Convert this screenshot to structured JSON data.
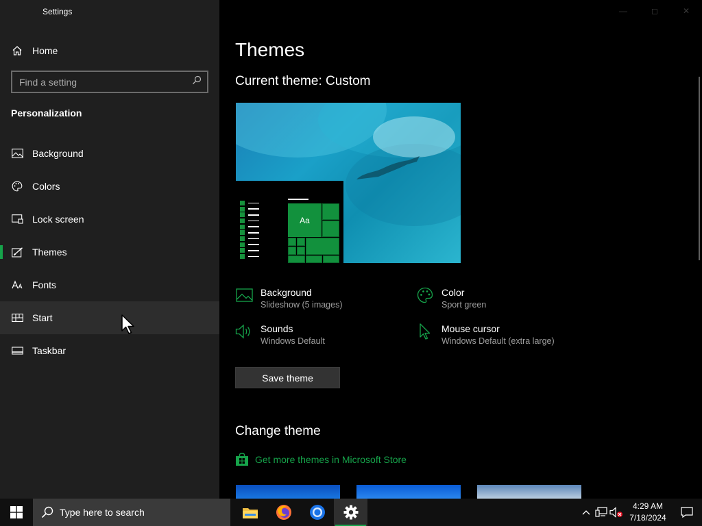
{
  "app": {
    "title": "Settings"
  },
  "sidebar": {
    "home_label": "Home",
    "search_placeholder": "Find a setting",
    "section_title": "Personalization",
    "items": [
      {
        "label": "Background",
        "icon": "picture-icon"
      },
      {
        "label": "Colors",
        "icon": "palette-icon"
      },
      {
        "label": "Lock screen",
        "icon": "lock-screen-icon"
      },
      {
        "label": "Themes",
        "icon": "brush-icon",
        "selected": true
      },
      {
        "label": "Fonts",
        "icon": "font-icon"
      },
      {
        "label": "Start",
        "icon": "start-icon",
        "hovered": true
      },
      {
        "label": "Taskbar",
        "icon": "taskbar-icon"
      }
    ]
  },
  "main": {
    "title": "Themes",
    "current_theme": "Current theme: Custom",
    "preview_tile_text": "Aa",
    "properties": [
      {
        "title": "Background",
        "subtitle": "Slideshow (5 images)",
        "icon": "picture-icon"
      },
      {
        "title": "Color",
        "subtitle": "Sport green",
        "icon": "palette-icon"
      },
      {
        "title": "Sounds",
        "subtitle": "Windows Default",
        "icon": "speaker-icon"
      },
      {
        "title": "Mouse cursor",
        "subtitle": "Windows Default (extra large)",
        "icon": "cursor-icon"
      }
    ],
    "save_button": "Save theme",
    "change_title": "Change theme",
    "store_link": "Get more themes in Microsoft Store"
  },
  "taskbar": {
    "search_placeholder": "Type here to search",
    "apps": [
      "file-explorer-icon",
      "firefox-icon",
      "chrome-icon",
      "settings-gear-icon"
    ],
    "time": "4:29 AM",
    "date": "7/18/2024"
  },
  "colors": {
    "accent": "#16a34a",
    "sidebar_bg": "#1f1f1f",
    "main_bg": "#000000"
  }
}
